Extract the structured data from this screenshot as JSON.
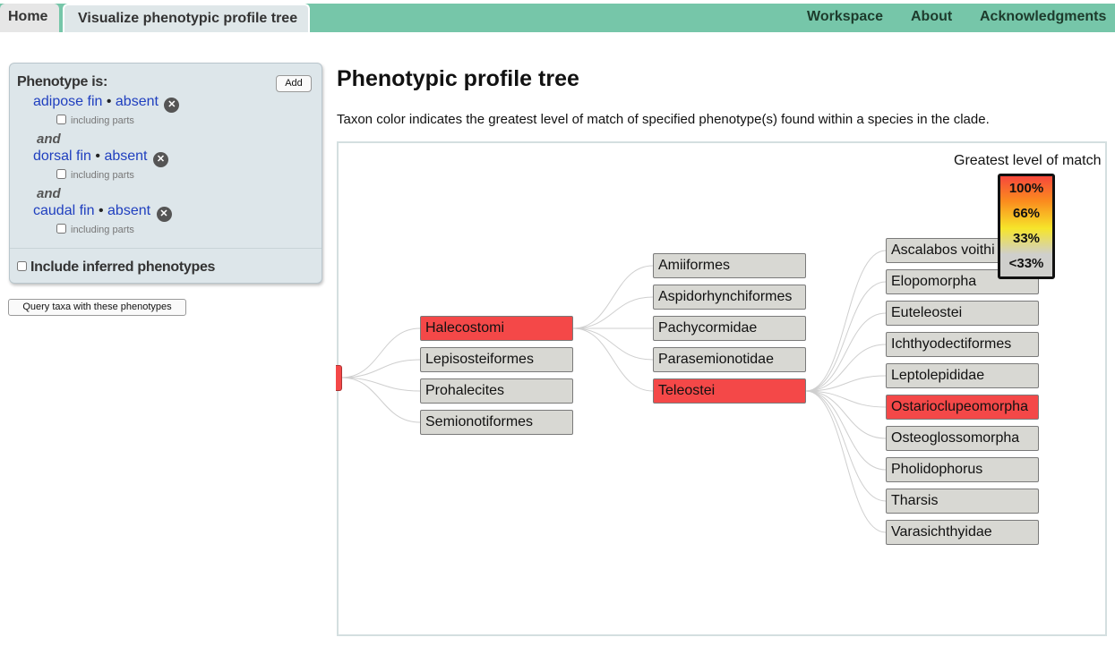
{
  "nav": {
    "home": "Home",
    "current": "Visualize phenotypic profile tree",
    "links": [
      "Workspace",
      "About",
      "Acknowledgments"
    ]
  },
  "sidebar": {
    "title": "Phenotype is:",
    "add_label": "Add",
    "terms": [
      {
        "entity": "adipose fin",
        "sep": "•",
        "quality": "absent",
        "parts_label": "including parts"
      },
      {
        "entity": "dorsal fin",
        "sep": "•",
        "quality": "absent",
        "parts_label": "including parts"
      },
      {
        "entity": "caudal fin",
        "sep": "•",
        "quality": "absent",
        "parts_label": "including parts"
      }
    ],
    "and_label": "and",
    "inferred_label": "Include inferred phenotypes",
    "query_button": "Query taxa with these phenotypes"
  },
  "main": {
    "title": "Phenotypic profile tree",
    "description": "Taxon color indicates the greatest level of match of specified phenotype(s) found within a species in the clade."
  },
  "legend": {
    "title": "Greatest level of match",
    "levels": [
      "100%",
      "66%",
      "33%",
      "<33%"
    ],
    "colors": {
      "match_100": "#f44848",
      "no_match": "#d8d8d3"
    }
  },
  "tree": {
    "level1": [
      {
        "name": "Halecostomi",
        "match": "100%"
      },
      {
        "name": "Lepisosteiformes",
        "match": "<33%"
      },
      {
        "name": "Prohalecites",
        "match": "<33%"
      },
      {
        "name": "Semionotiformes",
        "match": "<33%"
      }
    ],
    "level2": [
      {
        "name": "Amiiformes",
        "match": "<33%"
      },
      {
        "name": "Aspidorhynchiformes",
        "match": "<33%"
      },
      {
        "name": "Pachycormidae",
        "match": "<33%"
      },
      {
        "name": "Parasemionotidae",
        "match": "<33%"
      },
      {
        "name": "Teleostei",
        "match": "100%"
      }
    ],
    "level3": [
      {
        "name": "Ascalabos voithi",
        "match": "<33%"
      },
      {
        "name": "Elopomorpha",
        "match": "<33%"
      },
      {
        "name": "Euteleostei",
        "match": "<33%"
      },
      {
        "name": "Ichthyodectiformes",
        "match": "<33%"
      },
      {
        "name": "Leptolepididae",
        "match": "<33%"
      },
      {
        "name": "Ostarioclupeomorpha",
        "match": "100%"
      },
      {
        "name": "Osteoglossomorpha",
        "match": "<33%"
      },
      {
        "name": "Pholidophorus",
        "match": "<33%"
      },
      {
        "name": "Tharsis",
        "match": "<33%"
      },
      {
        "name": "Varasichthyidae",
        "match": "<33%"
      }
    ]
  }
}
